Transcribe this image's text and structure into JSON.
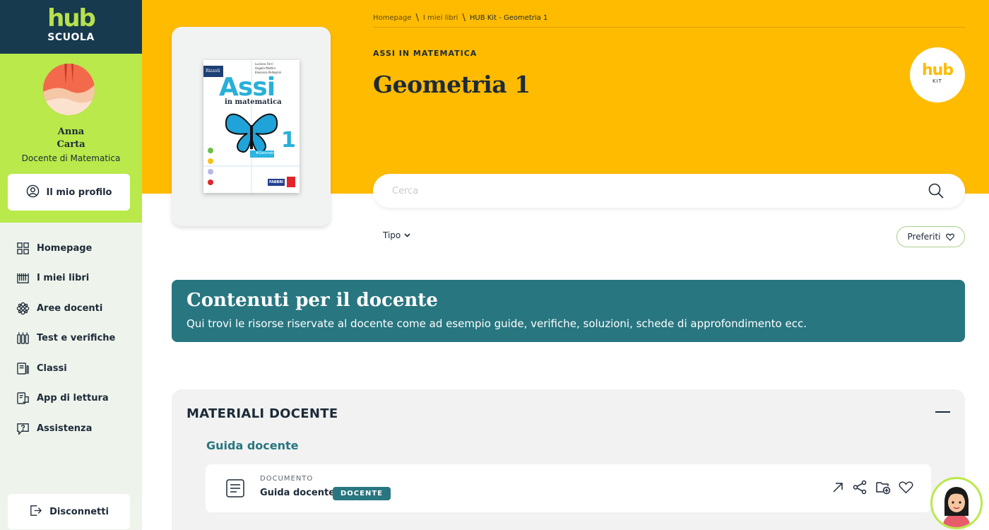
{
  "brand": {
    "logo_main": "hub",
    "logo_sub": "SCUOLA",
    "accent": "#b9e94a",
    "dark": "#173a4f",
    "band_color": "#ffbb00",
    "teal": "#287680"
  },
  "user": {
    "first_name": "Anna",
    "last_name": "Carta",
    "role": "Docente di Matematica"
  },
  "sidebar": {
    "profile_label": "Il mio profilo",
    "items": [
      {
        "label": "Homepage",
        "icon": "grid-icon"
      },
      {
        "label": "I miei libri",
        "icon": "books-icon"
      },
      {
        "label": "Aree docenti",
        "icon": "flower-icon"
      },
      {
        "label": "Test e verifiche",
        "icon": "tests-icon"
      },
      {
        "label": "Classi",
        "icon": "classroom-icon"
      },
      {
        "label": "App di lettura",
        "icon": "reader-app-icon"
      },
      {
        "label": "Assistenza",
        "icon": "help-chat-icon"
      }
    ],
    "logout_label": "Disconnetti"
  },
  "breadcrumb": [
    "Homepage",
    "I miei libri",
    "HUB Kit - Geometria 1"
  ],
  "header": {
    "series": "ASSI IN MATEMATICA",
    "title": "Geometria 1",
    "kit_logo": "hub",
    "kit_sub": "KIT"
  },
  "cover": {
    "publisher": "Rizzoli",
    "authors": [
      "Luciano Ferri",
      "Angela Mattini",
      "Eleonora Pellegrini"
    ],
    "title": "Assi",
    "subtitle": "in matematica",
    "volume": "1",
    "tag": "#Geometria",
    "imprint": "FABBRI"
  },
  "search": {
    "placeholder": "Cerca",
    "value": ""
  },
  "filters": {
    "type_label": "Tipo",
    "favorites_label": "Preferiti"
  },
  "teacher_banner": {
    "title": "Contenuti per il docente",
    "description": "Qui trovi le risorse riservate al docente come ad esempio guide, verifiche, soluzioni, schede di approfondimento ecc."
  },
  "materials": {
    "title": "MATERIALI DOCENTE",
    "section": "Guida docente",
    "items": [
      {
        "type": "DOCUMENTO",
        "name": "Guida docente",
        "badge": "DOCENTE"
      }
    ]
  }
}
